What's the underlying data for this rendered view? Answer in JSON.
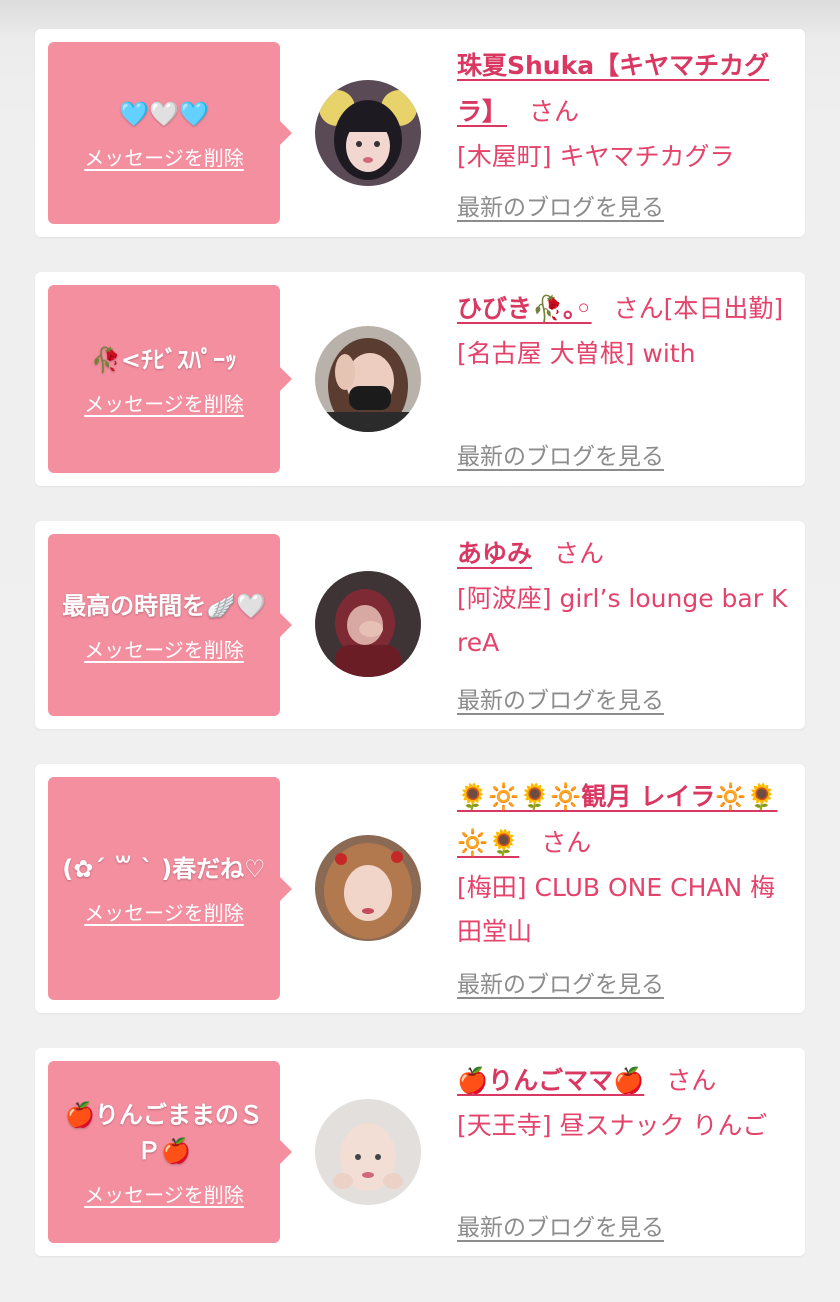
{
  "theme": {
    "bubble_color": "#f48fa0",
    "name_color": "#d93862",
    "link_gray": "#8c8c8c"
  },
  "cards": [
    {
      "message": "🩵🤍🩵",
      "delete_label": "メッセージを削除",
      "name": "珠夏Shuka【キヤマチカグラ】",
      "honorific": "さん",
      "shop": "[木屋町] キヤマチカグラ",
      "blog_label": "最新のブログを見る",
      "avatar_icon": "avatar-photo"
    },
    {
      "message": "🥀<ﾁﾋﾞｽﾊﾟｰｯ",
      "delete_label": "メッセージを削除",
      "name": "ひびき🥀｡◦",
      "honorific": "さん[本日出勤]",
      "shop": "[名古屋 大曽根] with",
      "blog_label": "最新のブログを見る",
      "avatar_icon": "avatar-photo"
    },
    {
      "message": "最高の時間を🪽🤍",
      "delete_label": "メッセージを削除",
      "name": "あゆみ",
      "honorific": "さん",
      "shop": "[阿波座] girl’s lounge bar KreA",
      "blog_label": "最新のブログを見る",
      "avatar_icon": "avatar-photo"
    },
    {
      "message": "(✿´ ꒳ ` )春だね♡",
      "delete_label": "メッセージを削除",
      "name": "🌻🔆🌻🔆観月 レイラ🔆🌻🔆🌻",
      "honorific": "さん",
      "shop": "[梅田] CLUB ONE CHAN 梅田堂山",
      "blog_label": "最新のブログを見る",
      "avatar_icon": "avatar-photo"
    },
    {
      "message": "🍎りんごままのＳＰ🍎",
      "delete_label": "メッセージを削除",
      "name": "🍎りんごママ🍎",
      "honorific": "さん",
      "shop": "[天王寺] 昼スナック りんご",
      "blog_label": "最新のブログを見る",
      "avatar_icon": "avatar-photo"
    }
  ]
}
